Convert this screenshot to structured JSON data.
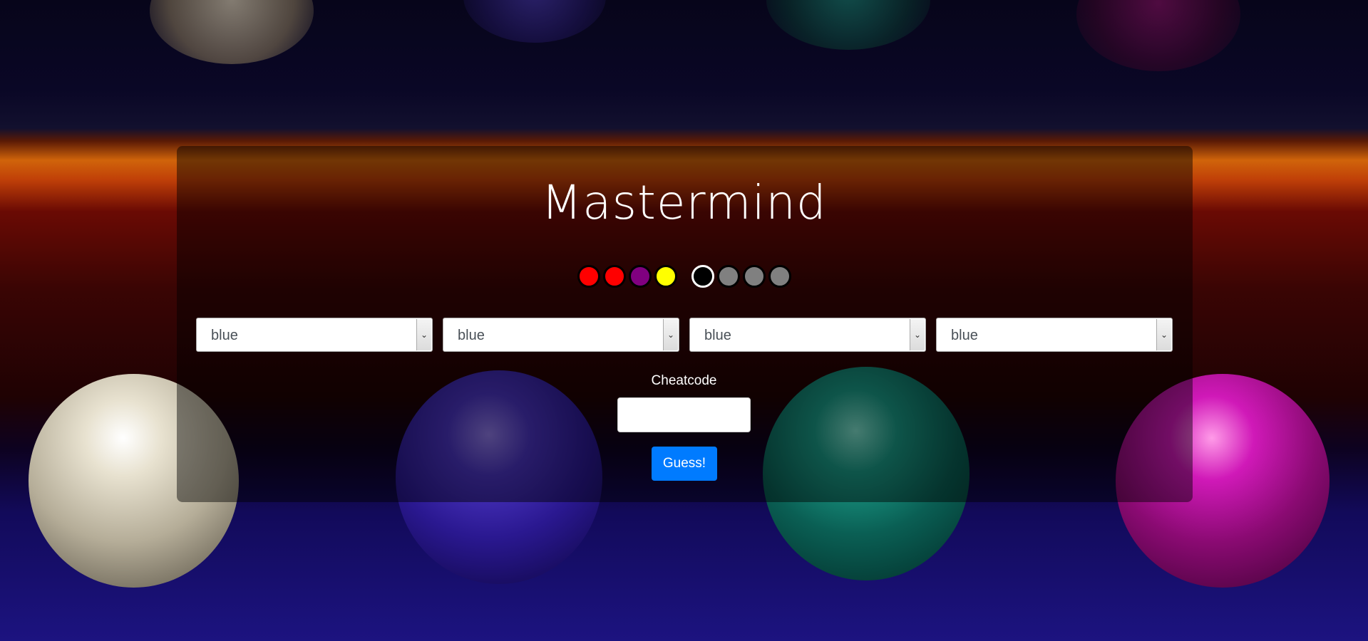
{
  "title": "Mastermind",
  "guess_pegs": [
    {
      "color": "#ff0000",
      "name": "red"
    },
    {
      "color": "#ff0000",
      "name": "red"
    },
    {
      "color": "#800080",
      "name": "purple"
    },
    {
      "color": "#ffff00",
      "name": "yellow"
    }
  ],
  "result_pegs": [
    {
      "color": "#000000",
      "name": "black"
    },
    {
      "color": "#808080",
      "name": "gray"
    },
    {
      "color": "#808080",
      "name": "gray"
    },
    {
      "color": "#808080",
      "name": "gray"
    }
  ],
  "selects": [
    {
      "value": "blue"
    },
    {
      "value": "blue"
    },
    {
      "value": "blue"
    },
    {
      "value": "blue"
    }
  ],
  "cheatcode": {
    "label": "Cheatcode",
    "value": ""
  },
  "guess_button": {
    "label": "Guess!",
    "color": "#007bff"
  }
}
